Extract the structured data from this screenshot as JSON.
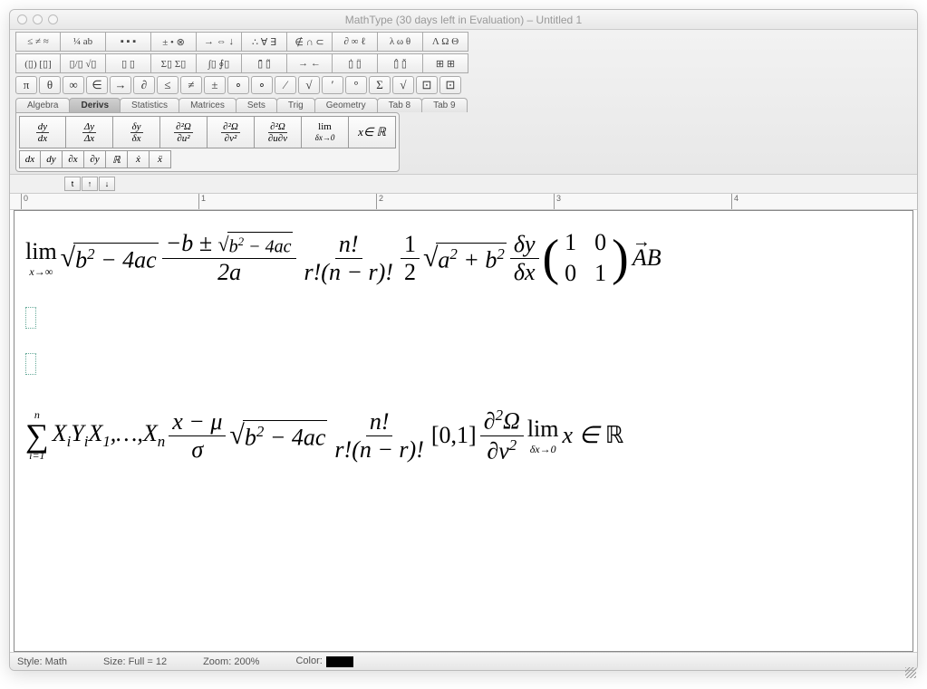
{
  "window": {
    "title": "MathType (30 days left in Evaluation) – Untitled 1"
  },
  "palette": {
    "row1": [
      "≤ ≠ ≈",
      "¼ ab",
      "▪ ▪ ▪",
      "± • ⊗",
      "→ ⇔ ↓",
      "∴ ∀ ∃",
      "∉ ∩ ⊂",
      "∂ ∞ ℓ",
      "λ ω θ",
      "Λ Ω Θ"
    ],
    "row2": [
      "(▯) [▯]",
      "▯/▯  √▯",
      "▯ ▯",
      "Σ▯ Σ▯",
      "∫▯ ∮▯",
      "▯̄ ▯̃",
      "→ ←",
      "▯̇ ▯̈",
      "▯̂ ▯̌",
      "⊞ ⊞"
    ]
  },
  "symbol_row": [
    "π",
    "θ",
    "∞",
    "∈",
    "→",
    "∂",
    "≤",
    "≠",
    "±",
    "∘",
    "∘",
    "⁄",
    "√",
    "′",
    "°",
    "Σ",
    "√",
    "⊡",
    "⊡"
  ],
  "tabs": [
    "Algebra",
    "Derivs",
    "Statistics",
    "Matrices",
    "Sets",
    "Trig",
    "Geometry",
    "Tab 8",
    "Tab 9"
  ],
  "active_tab": "Derivs",
  "deriv_cells_top": [
    "dy/dx",
    "Δy/Δx",
    "δy/δx",
    "∂²Ω/∂u²",
    "∂²Ω/∂v²",
    "∂²Ω/∂u∂v",
    "lim δx→0",
    "x ∈ ℝ"
  ],
  "deriv_cells_bot": [
    "dx",
    "dy",
    "∂x",
    "∂y",
    "ℝ",
    "ẋ",
    "ẍ"
  ],
  "mini": [
    "t",
    "↑",
    "↓"
  ],
  "ruler": {
    "marks": [
      0,
      1,
      2,
      3,
      4
    ]
  },
  "equations": {
    "line1": {
      "lim_label": "lim",
      "lim_sub": "x→∞",
      "sqrt1": "b² − 4ac",
      "quad_num": "−b ± √(b² − 4ac)",
      "quad_den": "2a",
      "binom_num": "n!",
      "binom_den": "r!(n − r)!",
      "half_num": "1",
      "half_den": "2",
      "pyth": "a² + b²",
      "dy": "δy",
      "dx": "δx",
      "m11": "1",
      "m12": "0",
      "m21": "0",
      "m22": "1",
      "vec": "AB"
    },
    "line2": {
      "sum_top": "n",
      "sum_bot": "i=1",
      "terms": "XᵢYᵢX₁,…,Xₙ",
      "zn": "x − μ",
      "zd": "σ",
      "sqrt": "b² − 4ac",
      "binom_num": "n!",
      "binom_den": "r!(n − r)!",
      "interval": "[0,1]",
      "pn": "∂²Ω",
      "pd": "∂v²",
      "lim_label": "lim",
      "lim_sub": "δx→0",
      "tail": "x ∈ ℝ"
    }
  },
  "status": {
    "style_label": "Style:",
    "style_value": "Math",
    "size_label": "Size:",
    "size_value": "Full = 12",
    "zoom_label": "Zoom:",
    "zoom_value": "200%",
    "color_label": "Color:"
  }
}
